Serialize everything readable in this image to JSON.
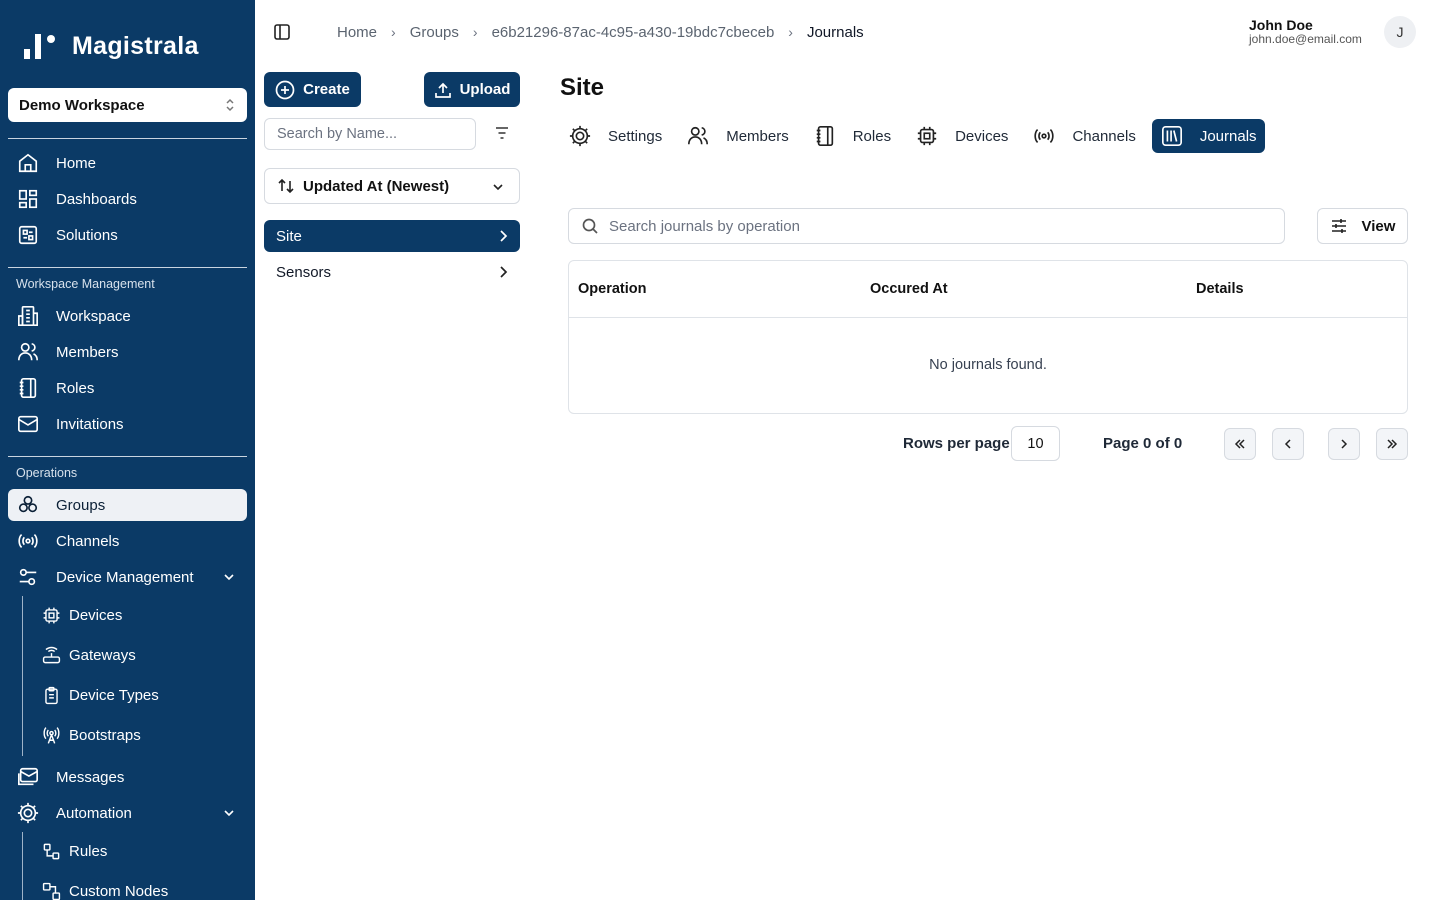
{
  "app": {
    "name": "Magistrala"
  },
  "workspace": {
    "selected": "Demo Workspace"
  },
  "sidebar": {
    "top_items": [
      {
        "label": "Home",
        "icon": "home-icon"
      },
      {
        "label": "Dashboards",
        "icon": "dashboard-icon"
      },
      {
        "label": "Solutions",
        "icon": "solutions-icon"
      }
    ],
    "workspace_section": {
      "label": "Workspace Management",
      "items": [
        {
          "label": "Workspace",
          "icon": "building-icon"
        },
        {
          "label": "Members",
          "icon": "users-icon"
        },
        {
          "label": "Roles",
          "icon": "notebook-icon"
        },
        {
          "label": "Invitations",
          "icon": "mail-icon"
        }
      ]
    },
    "operations_section": {
      "label": "Operations",
      "items": [
        {
          "label": "Groups",
          "icon": "groups-icon",
          "active": true
        },
        {
          "label": "Channels",
          "icon": "radio-icon"
        },
        {
          "label": "Device Management",
          "icon": "sliders-icon",
          "expanded": true
        }
      ],
      "device_management_children": [
        {
          "label": "Devices",
          "icon": "chip-icon"
        },
        {
          "label": "Gateways",
          "icon": "router-icon"
        },
        {
          "label": "Device Types",
          "icon": "clipboard-icon"
        },
        {
          "label": "Bootstraps",
          "icon": "antenna-icon"
        }
      ],
      "more_items": [
        {
          "label": "Messages",
          "icon": "messages-icon"
        },
        {
          "label": "Automation",
          "icon": "cog-icon",
          "expanded": true
        }
      ],
      "automation_children": [
        {
          "label": "Rules",
          "icon": "workflow-icon"
        },
        {
          "label": "Custom Nodes",
          "icon": "nodes-icon"
        }
      ]
    }
  },
  "breadcrumb": {
    "items": [
      "Home",
      "Groups",
      "e6b21296-87ac-4c95-a430-19bdc7cbeceb"
    ],
    "current": "Journals"
  },
  "user": {
    "name": "John Doe",
    "email": "john.doe@email.com",
    "initial": "J"
  },
  "groups_panel": {
    "create_label": "Create",
    "upload_label": "Upload",
    "search_placeholder": "Search by Name...",
    "sort_value": "Updated At (Newest)",
    "items": [
      {
        "label": "Site",
        "active": true
      },
      {
        "label": "Sensors",
        "active": false
      }
    ]
  },
  "main": {
    "title": "Site",
    "tabs": [
      {
        "label": "Settings",
        "icon": "settings-icon"
      },
      {
        "label": "Members",
        "icon": "users-icon"
      },
      {
        "label": "Roles",
        "icon": "notebook-icon"
      },
      {
        "label": "Devices",
        "icon": "chip-icon"
      },
      {
        "label": "Channels",
        "icon": "radio-icon"
      },
      {
        "label": "Journals",
        "icon": "library-icon",
        "active": true
      }
    ],
    "search_placeholder": "Search journals by operation",
    "view_label": "View",
    "table": {
      "columns": [
        "Operation",
        "Occured At",
        "Details"
      ],
      "empty_text": "No journals found."
    },
    "pagination": {
      "rows_per_page_label": "Rows per page",
      "rows_per_page_value": "10",
      "page_text": "Page 0 of 0"
    }
  },
  "colors": {
    "brand": "#0b3a66",
    "accent_active_bg": "#eef1f5"
  }
}
